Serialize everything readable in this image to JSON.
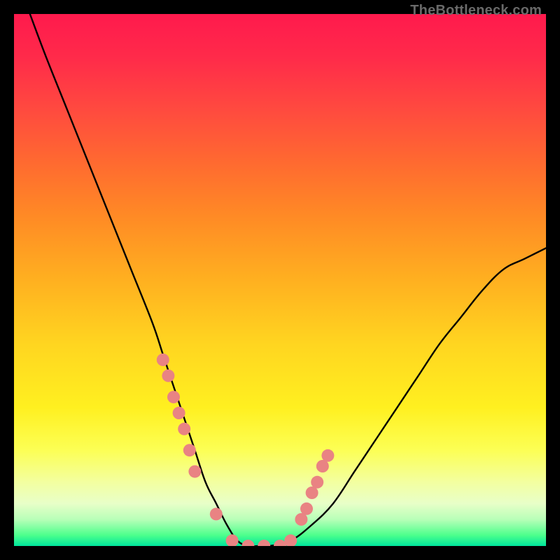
{
  "watermark": "TheBottleneck.com",
  "colors": {
    "curve": "#000000",
    "marker_fill": "#e98383",
    "marker_stroke": "#a04a4a",
    "background_top": "#ff1a4d",
    "background_bottom": "#00e59c"
  },
  "chart_data": {
    "type": "line",
    "title": "",
    "xlabel": "",
    "ylabel": "",
    "xlim": [
      0,
      100
    ],
    "ylim": [
      0,
      100
    ],
    "series": [
      {
        "name": "bottleneck-curve",
        "x": [
          3,
          6,
          10,
          14,
          18,
          22,
          26,
          28,
          30,
          32,
          34,
          36,
          38,
          40,
          42,
          44,
          46,
          48,
          52,
          56,
          60,
          64,
          68,
          72,
          76,
          80,
          84,
          88,
          92,
          96,
          100
        ],
        "y": [
          100,
          92,
          82,
          72,
          62,
          52,
          42,
          36,
          30,
          24,
          18,
          12,
          8,
          4,
          1,
          0,
          0,
          0,
          1,
          4,
          8,
          14,
          20,
          26,
          32,
          38,
          43,
          48,
          52,
          54,
          56
        ]
      }
    ],
    "markers": {
      "name": "highlight-points",
      "x": [
        28,
        29,
        30,
        31,
        32,
        33,
        34,
        38,
        41,
        44,
        47,
        50,
        52,
        54,
        55,
        56,
        57,
        58,
        59
      ],
      "y": [
        35,
        32,
        28,
        25,
        22,
        18,
        14,
        6,
        1,
        0,
        0,
        0,
        1,
        5,
        7,
        10,
        12,
        15,
        17
      ]
    }
  }
}
